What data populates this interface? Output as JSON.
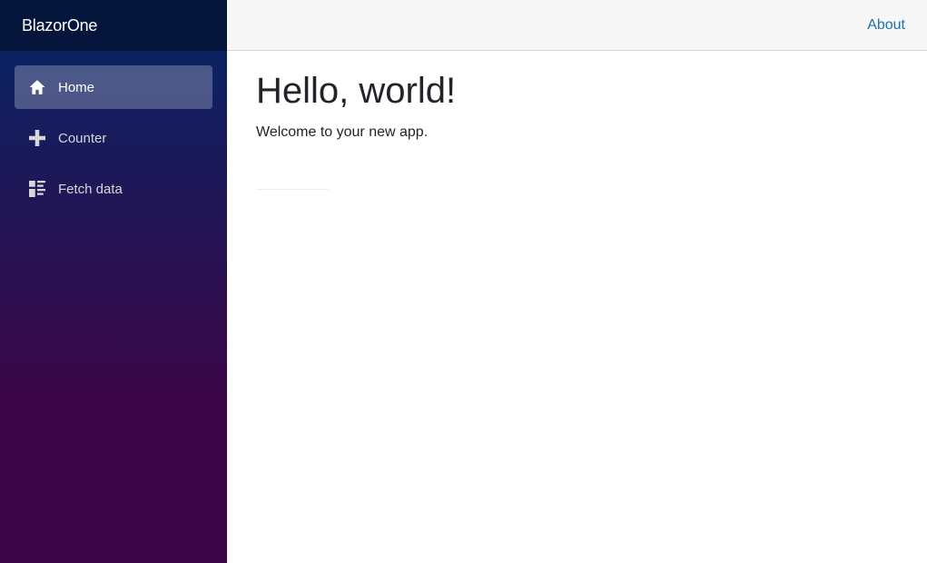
{
  "app": {
    "brand": "BlazorOne"
  },
  "sidebar": {
    "items": [
      {
        "label": "Home",
        "icon": "home-icon",
        "active": true
      },
      {
        "label": "Counter",
        "icon": "plus-icon",
        "active": false
      },
      {
        "label": "Fetch data",
        "icon": "list-rich-icon",
        "active": false
      }
    ]
  },
  "header": {
    "about_label": "About"
  },
  "main": {
    "title": "Hello, world!",
    "subtitle": "Welcome to your new app."
  },
  "colors": {
    "sidebar_gradient_top": "#052767",
    "sidebar_gradient_bottom": "#3a0647",
    "link": "#1b6ec2",
    "header_bg": "#f7f7f7"
  }
}
